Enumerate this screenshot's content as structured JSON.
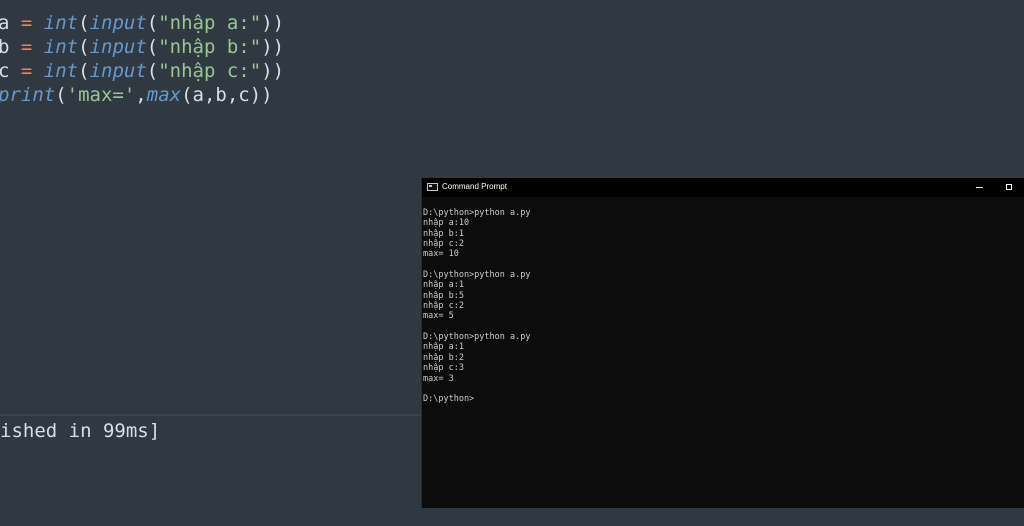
{
  "editor": {
    "code_lines": [
      [
        {
          "t": "a ",
          "k": "var"
        },
        {
          "t": "=",
          "k": "op"
        },
        {
          "t": " ",
          "k": "var"
        },
        {
          "t": "int",
          "k": "fn"
        },
        {
          "t": "(",
          "k": "paren"
        },
        {
          "t": "input",
          "k": "fn"
        },
        {
          "t": "(",
          "k": "paren"
        },
        {
          "t": "\"nhập a:\"",
          "k": "str"
        },
        {
          "t": "))",
          "k": "paren"
        }
      ],
      [
        {
          "t": "b ",
          "k": "var"
        },
        {
          "t": "=",
          "k": "op"
        },
        {
          "t": " ",
          "k": "var"
        },
        {
          "t": "int",
          "k": "fn"
        },
        {
          "t": "(",
          "k": "paren"
        },
        {
          "t": "input",
          "k": "fn"
        },
        {
          "t": "(",
          "k": "paren"
        },
        {
          "t": "\"nhập b:\"",
          "k": "str"
        },
        {
          "t": "))",
          "k": "paren"
        }
      ],
      [
        {
          "t": "c ",
          "k": "var"
        },
        {
          "t": "=",
          "k": "op"
        },
        {
          "t": " ",
          "k": "var"
        },
        {
          "t": "int",
          "k": "fn"
        },
        {
          "t": "(",
          "k": "paren"
        },
        {
          "t": "input",
          "k": "fn"
        },
        {
          "t": "(",
          "k": "paren"
        },
        {
          "t": "\"nhập c:\"",
          "k": "str"
        },
        {
          "t": "))",
          "k": "paren"
        }
      ],
      [
        {
          "t": "print",
          "k": "fn"
        },
        {
          "t": "(",
          "k": "paren"
        },
        {
          "t": "'max='",
          "k": "str"
        },
        {
          "t": ",",
          "k": "paren"
        },
        {
          "t": "max",
          "k": "fn"
        },
        {
          "t": "(a,b,c))",
          "k": "paren"
        }
      ]
    ]
  },
  "output": {
    "line": "ished in 99ms]"
  },
  "cmd": {
    "title": "Command Prompt",
    "lines": [
      "D:\\python>python a.py",
      "nhập a:10",
      "nhập b:1",
      "nhập c:2",
      "max= 10",
      "",
      "D:\\python>python a.py",
      "nhập a:1",
      "nhập b:5",
      "nhập c:2",
      "max= 5",
      "",
      "D:\\python>python a.py",
      "nhập a:1",
      "nhập b:2",
      "nhập c:3",
      "max= 3",
      "",
      "D:\\python>"
    ]
  },
  "icons": {
    "cmd_app": "command-prompt-icon",
    "minimize": "minimize-icon",
    "maximize": "maximize-icon"
  },
  "colors": {
    "editor_bg": "#303841",
    "operator": "#f97b58",
    "function": "#6699cc",
    "string": "#99c794",
    "text": "#d8dee9",
    "console_bg": "#0c0c0c",
    "console_text": "#cccccc"
  }
}
